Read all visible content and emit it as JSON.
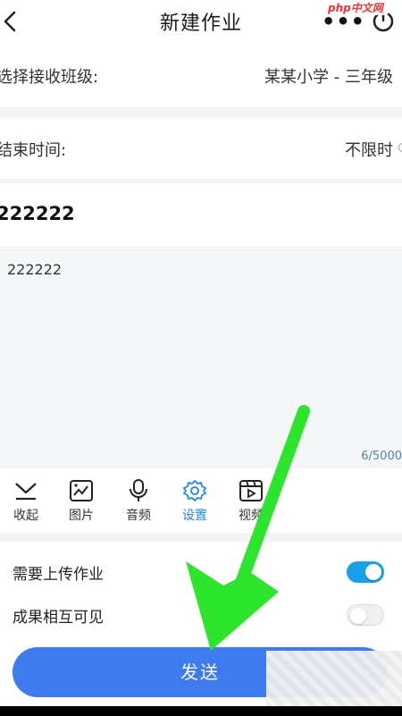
{
  "header": {
    "title": "新建作业",
    "watermark": "php中文网"
  },
  "form": {
    "class_label": "选择接收班级:",
    "class_value": "某某小学 - 三年级",
    "end_time_label": "结束时间:",
    "end_time_value": "不限时",
    "homework_title": "222222",
    "content_text": "222222",
    "char_counter": "6/5000"
  },
  "toolbar": {
    "items": [
      {
        "label": "收起",
        "icon": "collapse-icon"
      },
      {
        "label": "图片",
        "icon": "image-icon"
      },
      {
        "label": "音频",
        "icon": "microphone-icon"
      },
      {
        "label": "设置",
        "icon": "settings-gear-icon",
        "active": true
      },
      {
        "label": "视频",
        "icon": "video-icon"
      }
    ]
  },
  "options": {
    "upload_label": "需要上传作业",
    "upload_enabled": true,
    "share_label": "成果相互可见",
    "share_enabled": false
  },
  "send_button": "发送",
  "colors": {
    "accent": "#1e88e5",
    "send_button": "#3d7bee",
    "toggle_on": "#1aa0e8",
    "arrow": "#2ee52e"
  }
}
